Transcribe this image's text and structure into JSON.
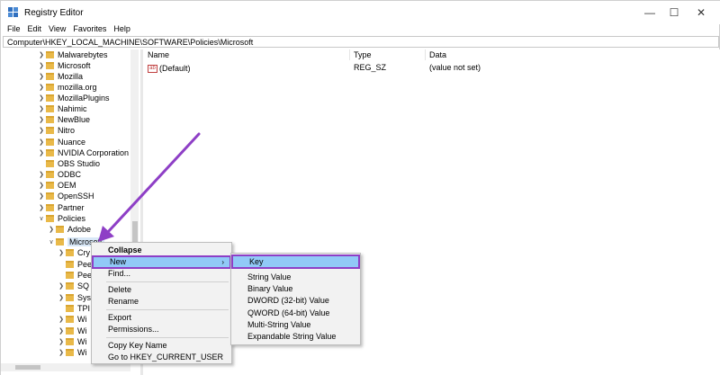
{
  "window": {
    "title": "Registry Editor",
    "controls": {
      "minimize": "—",
      "maximize": "☐",
      "close": "✕"
    }
  },
  "menubar": [
    "File",
    "Edit",
    "View",
    "Favorites",
    "Help"
  ],
  "address": "Computer\\HKEY_LOCAL_MACHINE\\SOFTWARE\\Policies\\Microsoft",
  "tree": {
    "items": [
      {
        "label": "Malwarebytes"
      },
      {
        "label": "Microsoft"
      },
      {
        "label": "Mozilla"
      },
      {
        "label": "mozilla.org"
      },
      {
        "label": "MozillaPlugins"
      },
      {
        "label": "Nahimic"
      },
      {
        "label": "NewBlue"
      },
      {
        "label": "Nitro"
      },
      {
        "label": "Nuance"
      },
      {
        "label": "NVIDIA Corporation"
      },
      {
        "label": "OBS Studio"
      },
      {
        "label": "ODBC"
      },
      {
        "label": "OEM"
      },
      {
        "label": "OpenSSH"
      },
      {
        "label": "Partner"
      },
      {
        "label": "Policies"
      },
      {
        "label": "Adobe"
      },
      {
        "label": "Microsoft"
      }
    ],
    "children": [
      {
        "label": "Cry"
      },
      {
        "label": "Pee"
      },
      {
        "label": "Pee"
      },
      {
        "label": "SQ"
      },
      {
        "label": "Sys"
      },
      {
        "label": "TPI"
      },
      {
        "label": "Wi"
      },
      {
        "label": "Wi"
      },
      {
        "label": "Wi"
      },
      {
        "label": "Wi"
      }
    ]
  },
  "list": {
    "columns": {
      "name": "Name",
      "type": "Type",
      "data": "Data"
    },
    "rows": [
      {
        "name": "(Default)",
        "type": "REG_SZ",
        "data": "(value not set)",
        "icon": "ab"
      }
    ]
  },
  "context_menu": {
    "items": [
      {
        "label": "Collapse"
      },
      {
        "label": "New",
        "arrow": "›"
      },
      {
        "label": "Find..."
      },
      {
        "label": "Delete"
      },
      {
        "label": "Rename"
      },
      {
        "label": "Export"
      },
      {
        "label": "Permissions..."
      },
      {
        "label": "Copy Key Name"
      },
      {
        "label": "Go to HKEY_CURRENT_USER"
      }
    ]
  },
  "submenu": {
    "items": [
      {
        "label": "Key"
      },
      {
        "label": "String Value"
      },
      {
        "label": "Binary Value"
      },
      {
        "label": "DWORD (32-bit) Value"
      },
      {
        "label": "QWORD (64-bit) Value"
      },
      {
        "label": "Multi-String Value"
      },
      {
        "label": "Expandable String Value"
      }
    ]
  },
  "colors": {
    "highlight": "#91c9f7",
    "annotation": "#8e3fc6",
    "folder": "#e9b949"
  }
}
